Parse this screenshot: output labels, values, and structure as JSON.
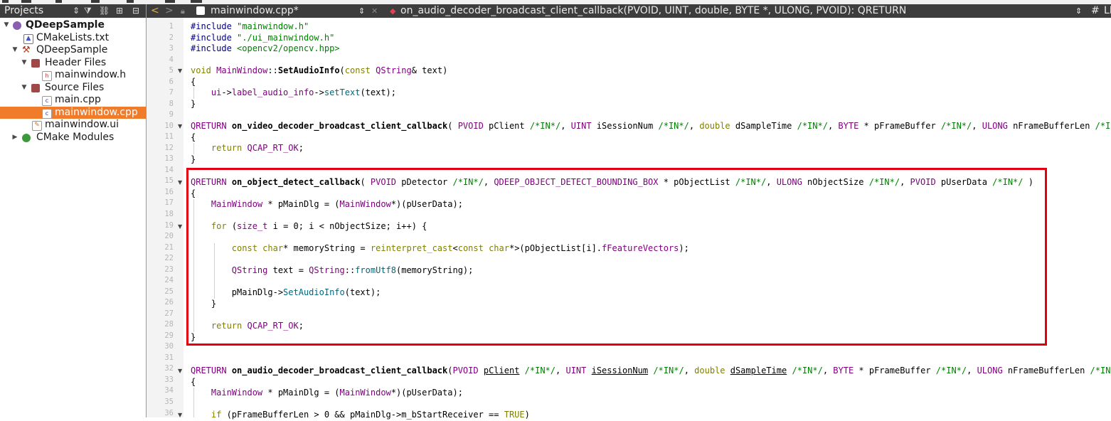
{
  "projects_panel": {
    "title": "Projects",
    "tree": [
      {
        "label": "QDeepSample",
        "depth": 0,
        "expanded": true,
        "bold": true,
        "icon": "project-icon"
      },
      {
        "label": "CMakeLists.txt",
        "depth": 1,
        "icon": "cmake-file-icon"
      },
      {
        "label": "QDeepSample",
        "depth": 1,
        "expanded": true,
        "icon": "hammer-icon"
      },
      {
        "label": "Header Files",
        "depth": 2,
        "expanded": true,
        "icon": "folder-icon"
      },
      {
        "label": "mainwindow.h",
        "depth": 3,
        "icon": "header-file-icon"
      },
      {
        "label": "Source Files",
        "depth": 2,
        "expanded": true,
        "icon": "folder-icon"
      },
      {
        "label": "main.cpp",
        "depth": 3,
        "icon": "cpp-file-icon"
      },
      {
        "label": "mainwindow.cpp",
        "depth": 3,
        "icon": "cpp-file-icon",
        "selected": true
      },
      {
        "label": "mainwindow.ui",
        "depth": 2,
        "icon": "ui-file-icon"
      },
      {
        "label": "CMake Modules",
        "depth": 1,
        "expanded": false,
        "icon": "cmake-modules-icon"
      }
    ]
  },
  "editor": {
    "file_tab": "mainwindow.cpp*",
    "function_selector": "on_audio_decoder_broadcast_client_callback(PVOID, UINT, double, BYTE *, ULONG, PVOID): QRETURN",
    "hash_symbol": "#",
    "line_ending": "LF",
    "line_numbers": [
      "1",
      "2",
      "3",
      "4",
      "5",
      "6",
      "7",
      "8",
      "9",
      "10",
      "11",
      "12",
      "13",
      "14",
      "15",
      "16",
      "17",
      "18",
      "19",
      "20",
      "21",
      "22",
      "23",
      "24",
      "25",
      "26",
      "27",
      "28",
      "29",
      "30",
      "31",
      "32",
      "33",
      "34",
      "35",
      "36"
    ]
  },
  "colors": {
    "selection": "#f07b2a",
    "highlight_box": "#e3000f",
    "toolbar_bg": "#3d3d3d"
  }
}
